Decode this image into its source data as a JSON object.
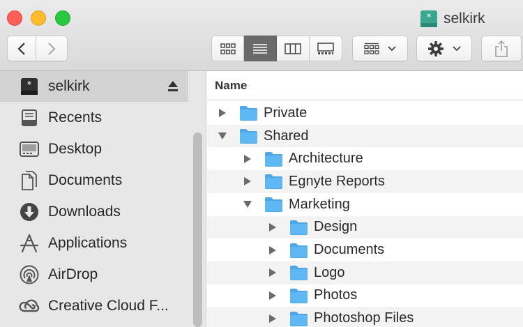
{
  "window": {
    "title": "selkirk"
  },
  "colors": {
    "folder": "#5fb8f3",
    "selection": "#d2d2d2",
    "active_segment": "#6a6a6a"
  },
  "toolbar": {
    "nav": [
      "chevron-left-icon",
      "chevron-right-icon"
    ],
    "view_modes": [
      "icon-view",
      "list-view",
      "column-view",
      "gallery-view"
    ],
    "active_view": "list-view",
    "arrange_icon": "grid-arrange-icon",
    "action_icon": "gear-icon",
    "share_icon": "share-icon"
  },
  "sidebar": {
    "items": [
      {
        "label": "selkirk",
        "icon": "drive-icon",
        "selected": true,
        "eject": true
      },
      {
        "label": "Recents",
        "icon": "recents-icon"
      },
      {
        "label": "Desktop",
        "icon": "desktop-icon"
      },
      {
        "label": "Documents",
        "icon": "documents-icon"
      },
      {
        "label": "Downloads",
        "icon": "downloads-icon"
      },
      {
        "label": "Applications",
        "icon": "applications-icon"
      },
      {
        "label": "AirDrop",
        "icon": "airdrop-icon"
      },
      {
        "label": "Creative Cloud F...",
        "icon": "creative-cloud-icon"
      }
    ]
  },
  "list": {
    "column_header": "Name",
    "rows": [
      {
        "name": "Private",
        "level": 0,
        "expanded": false
      },
      {
        "name": "Shared",
        "level": 0,
        "expanded": true
      },
      {
        "name": "Architecture",
        "level": 1,
        "expanded": false
      },
      {
        "name": "Egnyte Reports",
        "level": 1,
        "expanded": false
      },
      {
        "name": "Marketing",
        "level": 1,
        "expanded": true
      },
      {
        "name": "Design",
        "level": 2,
        "expanded": false
      },
      {
        "name": "Documents",
        "level": 2,
        "expanded": false
      },
      {
        "name": "Logo",
        "level": 2,
        "expanded": false
      },
      {
        "name": "Photos",
        "level": 2,
        "expanded": false
      },
      {
        "name": "Photoshop Files",
        "level": 2,
        "expanded": false
      }
    ]
  }
}
